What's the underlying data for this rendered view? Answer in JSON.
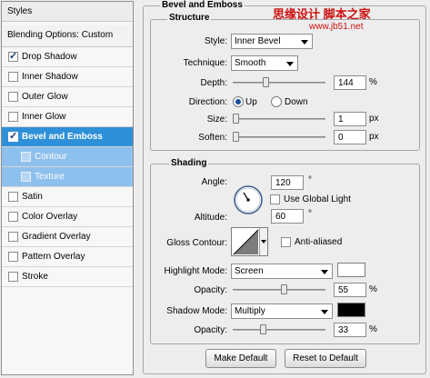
{
  "sidebar": {
    "header": "Styles",
    "blending": "Blending Options: Custom",
    "items": [
      {
        "label": "Drop Shadow",
        "checked": true
      },
      {
        "label": "Inner Shadow",
        "checked": false
      },
      {
        "label": "Outer Glow",
        "checked": false
      },
      {
        "label": "Inner Glow",
        "checked": false
      },
      {
        "label": "Bevel and Emboss",
        "checked": true
      },
      {
        "label": "Contour",
        "checked": false
      },
      {
        "label": "Texture",
        "checked": false
      },
      {
        "label": "Satin",
        "checked": false
      },
      {
        "label": "Color Overlay",
        "checked": false
      },
      {
        "label": "Gradient Overlay",
        "checked": false
      },
      {
        "label": "Pattern Overlay",
        "checked": false
      },
      {
        "label": "Stroke",
        "checked": false
      }
    ]
  },
  "panel": {
    "title": "Bevel and Emboss"
  },
  "watermark": {
    "text": "思缘设计 脚本之家",
    "url": "www.jb51.net",
    "color": "#cc1111"
  },
  "structure": {
    "legend": "Structure",
    "style_label": "Style:",
    "style_value": "Inner Bevel",
    "technique_label": "Technique:",
    "technique_value": "Smooth",
    "depth_label": "Depth:",
    "depth_value": "144",
    "depth_unit": "%",
    "direction_label": "Direction:",
    "direction_up": "Up",
    "direction_down": "Down",
    "direction_selected": "Up",
    "size_label": "Size:",
    "size_value": "1",
    "size_unit": "px",
    "soften_label": "Soften:",
    "soften_value": "0",
    "soften_unit": "px"
  },
  "shading": {
    "legend": "Shading",
    "angle_label": "Angle:",
    "angle_value": "120",
    "angle_unit": "°",
    "global_light_label": "Use Global Light",
    "global_light_checked": false,
    "altitude_label": "Altitude:",
    "altitude_value": "60",
    "altitude_unit": "°",
    "gloss_label": "Gloss Contour:",
    "antialiased_label": "Anti-aliased",
    "antialiased_checked": false,
    "highlight_mode_label": "Highlight Mode:",
    "highlight_mode_value": "Screen",
    "highlight_color": "#ffffff",
    "highlight_opacity_label": "Opacity:",
    "highlight_opacity_value": "55",
    "highlight_opacity_unit": "%",
    "shadow_mode_label": "Shadow Mode:",
    "shadow_mode_value": "Multiply",
    "shadow_color": "#000000",
    "shadow_opacity_label": "Opacity:",
    "shadow_opacity_value": "33",
    "shadow_opacity_unit": "%"
  },
  "buttons": {
    "make_default": "Make Default",
    "reset_default": "Reset to Default"
  }
}
